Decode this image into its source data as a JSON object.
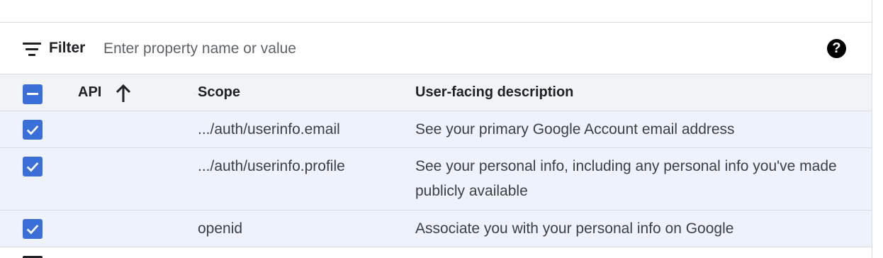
{
  "filter": {
    "label": "Filter",
    "placeholder": "Enter property name or value",
    "icon": "filter-icon",
    "help_icon": "help-icon",
    "help_glyph": "?"
  },
  "table": {
    "columns": {
      "api": "API",
      "scope": "Scope",
      "description": "User-facing description"
    },
    "sort": {
      "column": "API",
      "direction": "ascending",
      "icon": "arrow-up-icon"
    },
    "select_all_state": "indeterminate",
    "rows": [
      {
        "checked": true,
        "api": "",
        "scope": ".../auth/userinfo.email",
        "description": "See your primary Google Account email address"
      },
      {
        "checked": true,
        "api": "",
        "scope": ".../auth/userinfo.profile",
        "description": "See your personal info, including any personal info you've made publicly available"
      },
      {
        "checked": true,
        "api": "",
        "scope": "openid",
        "description": "Associate you with your personal info on Google"
      }
    ]
  },
  "colors": {
    "accent": "#3b6fd8",
    "header_bg": "#f1f3f4",
    "selected_row_bg": "#eef2fc",
    "border": "#dadce0"
  }
}
